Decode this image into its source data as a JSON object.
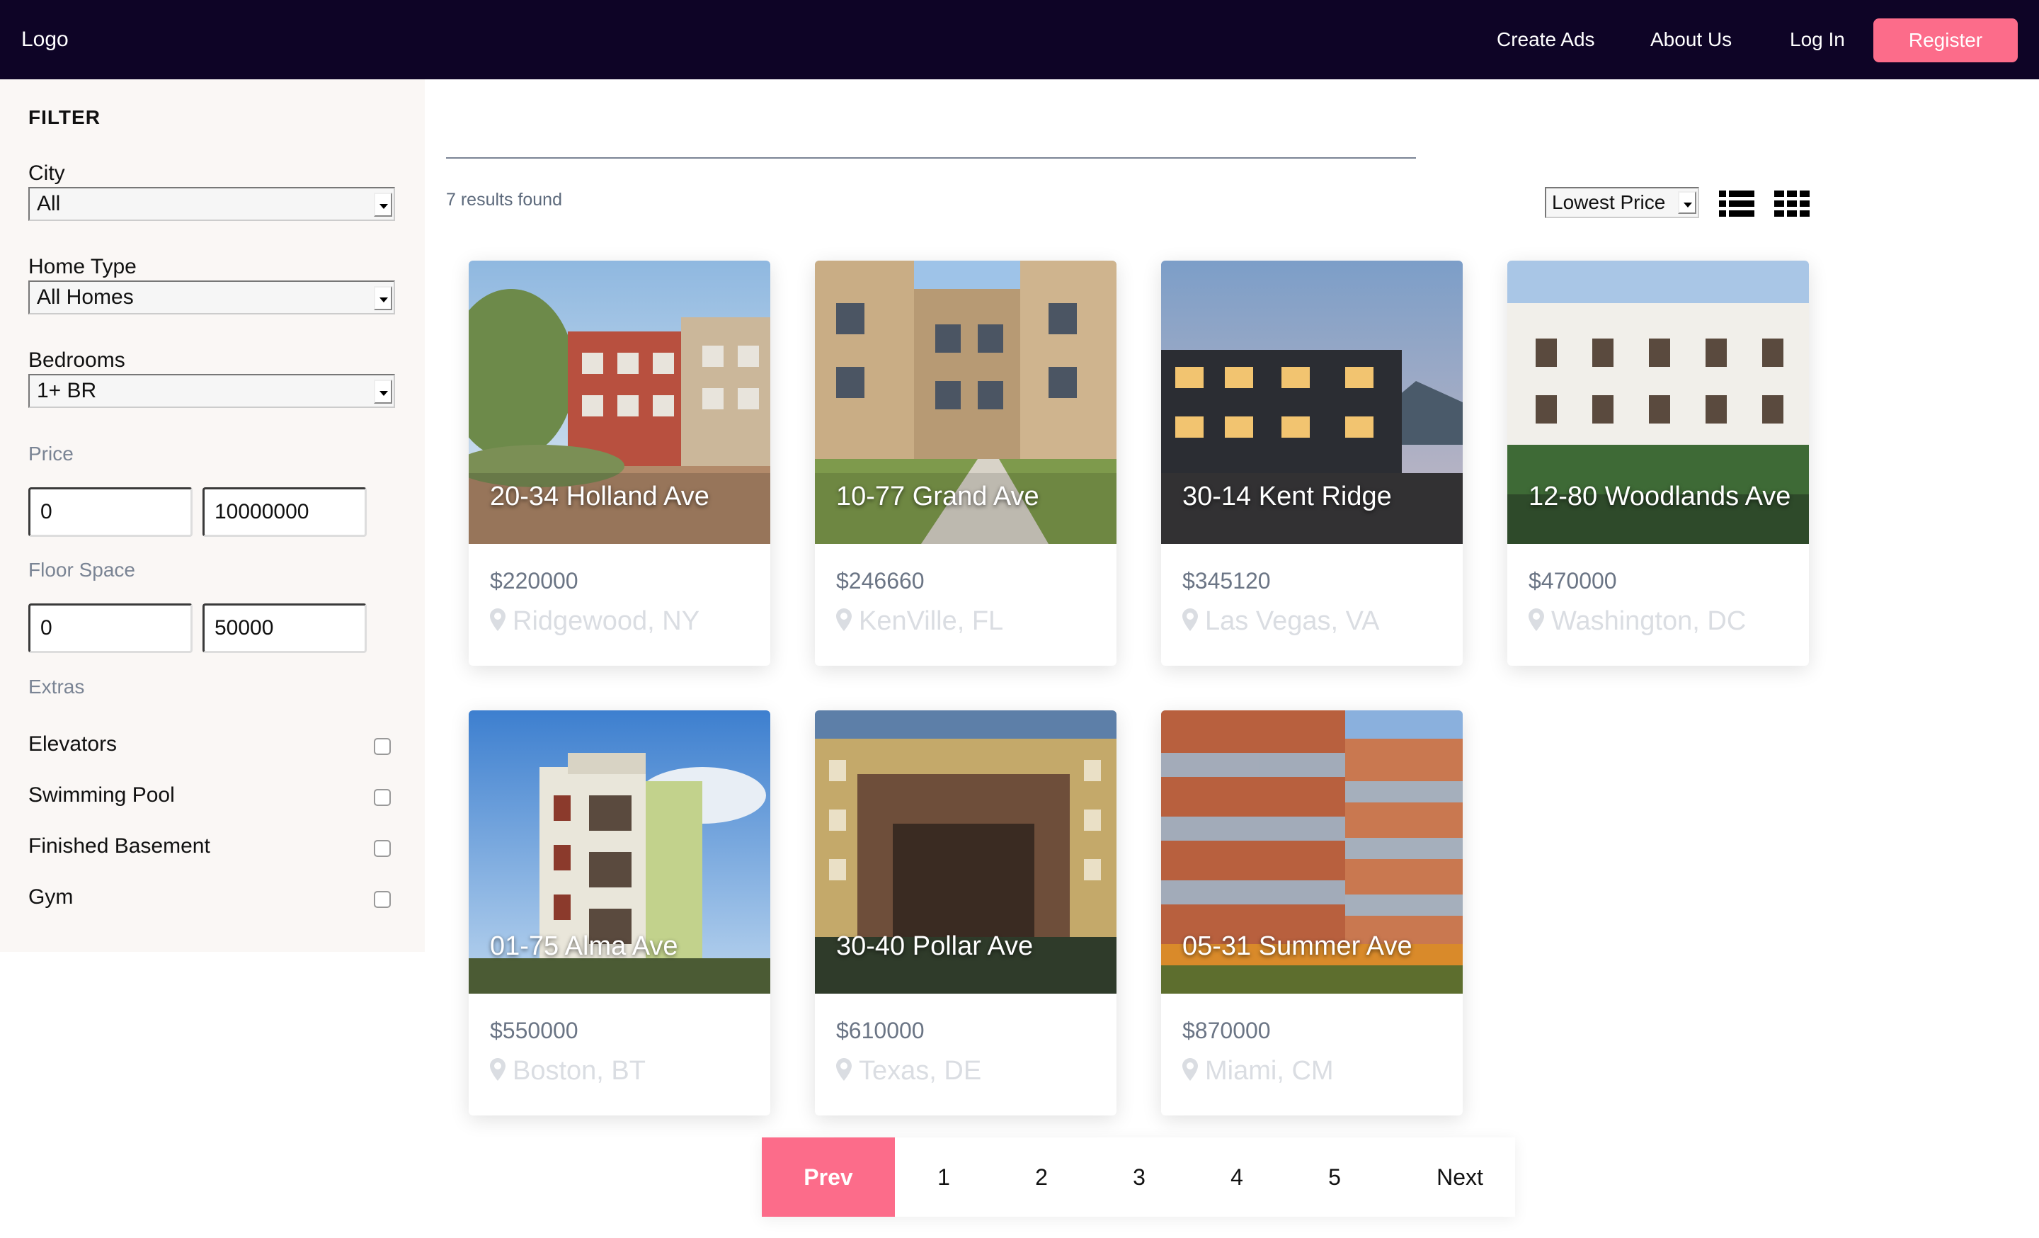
{
  "nav": {
    "logo": "Logo",
    "links": [
      "Create Ads",
      "About Us",
      "Log In"
    ],
    "register": "Register",
    "accent_color": "#fc6c8a",
    "bar_color": "#0e0426"
  },
  "filter": {
    "title": "FILTER",
    "city": {
      "label": "City",
      "value": "All"
    },
    "home_type": {
      "label": "Home Type",
      "value": "All Homes"
    },
    "bedrooms": {
      "label": "Bedrooms",
      "value": "1+ BR"
    },
    "price": {
      "label": "Price",
      "min": "0",
      "max": "10000000"
    },
    "floor_space": {
      "label": "Floor Space",
      "min": "0",
      "max": "50000"
    },
    "extras": {
      "label": "Extras",
      "items": [
        {
          "label": "Elevators",
          "checked": false
        },
        {
          "label": "Swimming Pool",
          "checked": false
        },
        {
          "label": "Finished Basement",
          "checked": false
        },
        {
          "label": "Gym",
          "checked": false
        }
      ]
    }
  },
  "results": {
    "count_text": "7 results found",
    "sort_value": "Lowest Price",
    "view_icons": [
      "list-view-icon",
      "grid-view-icon"
    ]
  },
  "listings": [
    {
      "title": "20-34 Holland Ave",
      "price": "$220000",
      "location": "Ridgewood, NY"
    },
    {
      "title": "10-77 Grand Ave",
      "price": "$246660",
      "location": "KenVille, FL"
    },
    {
      "title": "30-14 Kent Ridge",
      "price": "$345120",
      "location": "Las Vegas, VA"
    },
    {
      "title": "12-80 Woodlands Ave",
      "price": "$470000",
      "location": "Washington, DC"
    },
    {
      "title": "01-75 Alma Ave",
      "price": "$550000",
      "location": "Boston, BT"
    },
    {
      "title": "30-40 Pollar Ave",
      "price": "$610000",
      "location": "Texas, DE"
    },
    {
      "title": "05-31 Summer Ave",
      "price": "$870000",
      "location": "Miami, CM"
    }
  ],
  "pagination": {
    "prev": "Prev",
    "pages": [
      "1",
      "2",
      "3",
      "4",
      "5"
    ],
    "next": "Next"
  }
}
